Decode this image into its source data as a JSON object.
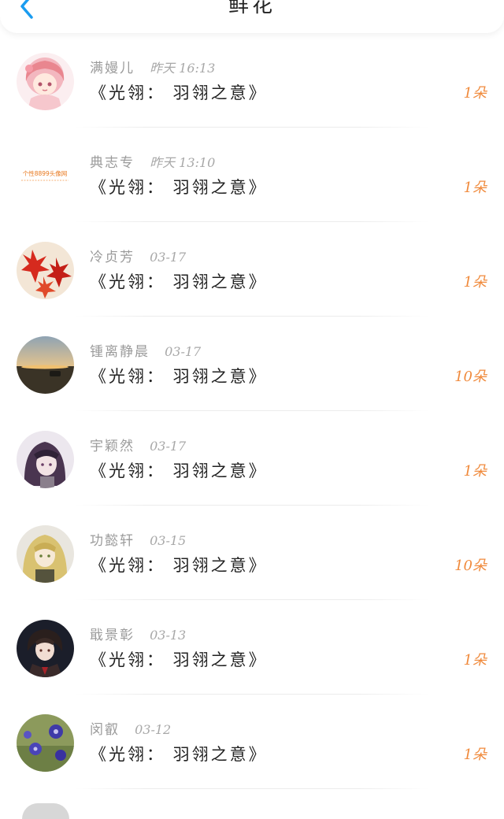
{
  "header": {
    "title": "鲜花",
    "back_icon": "chevron-left-icon",
    "accent": "#1a9cf0"
  },
  "colors": {
    "count": "#f08a3c",
    "meta": "#9b9b9b",
    "content": "#222222"
  },
  "items": [
    {
      "name": "满嫚儿",
      "time": "昨天 16:13",
      "content": "《光翎： 羽翎之意》",
      "count": "1朵",
      "avatar": "anime-girl-pink-avatar"
    },
    {
      "name": "典志专",
      "time": "昨天 13:10",
      "content": "《光翎： 羽翎之意》",
      "count": "1朵",
      "avatar": "text-logo-avatar",
      "avatar_text": "个性8899头像网"
    },
    {
      "name": "冷贞芳",
      "time": "03-17",
      "content": "《光翎： 羽翎之意》",
      "count": "1朵",
      "avatar": "red-maple-avatar"
    },
    {
      "name": "锺离静晨",
      "time": "03-17",
      "content": "《光翎： 羽翎之意》",
      "count": "10朵",
      "avatar": "sunset-landscape-avatar"
    },
    {
      "name": "宇颖然",
      "time": "03-17",
      "content": "《光翎： 羽翎之意》",
      "count": "1朵",
      "avatar": "anime-purple-hair-avatar"
    },
    {
      "name": "功懿轩",
      "time": "03-15",
      "content": "《光翎： 羽翎之意》",
      "count": "10朵",
      "avatar": "anime-blonde-avatar"
    },
    {
      "name": "戢景彰",
      "time": "03-13",
      "content": "《光翎： 羽翎之意》",
      "count": "1朵",
      "avatar": "anime-dark-suit-avatar"
    },
    {
      "name": "闵叡",
      "time": "03-12",
      "content": "《光翎： 羽翎之意》",
      "count": "1朵",
      "avatar": "blue-flowers-avatar"
    }
  ]
}
